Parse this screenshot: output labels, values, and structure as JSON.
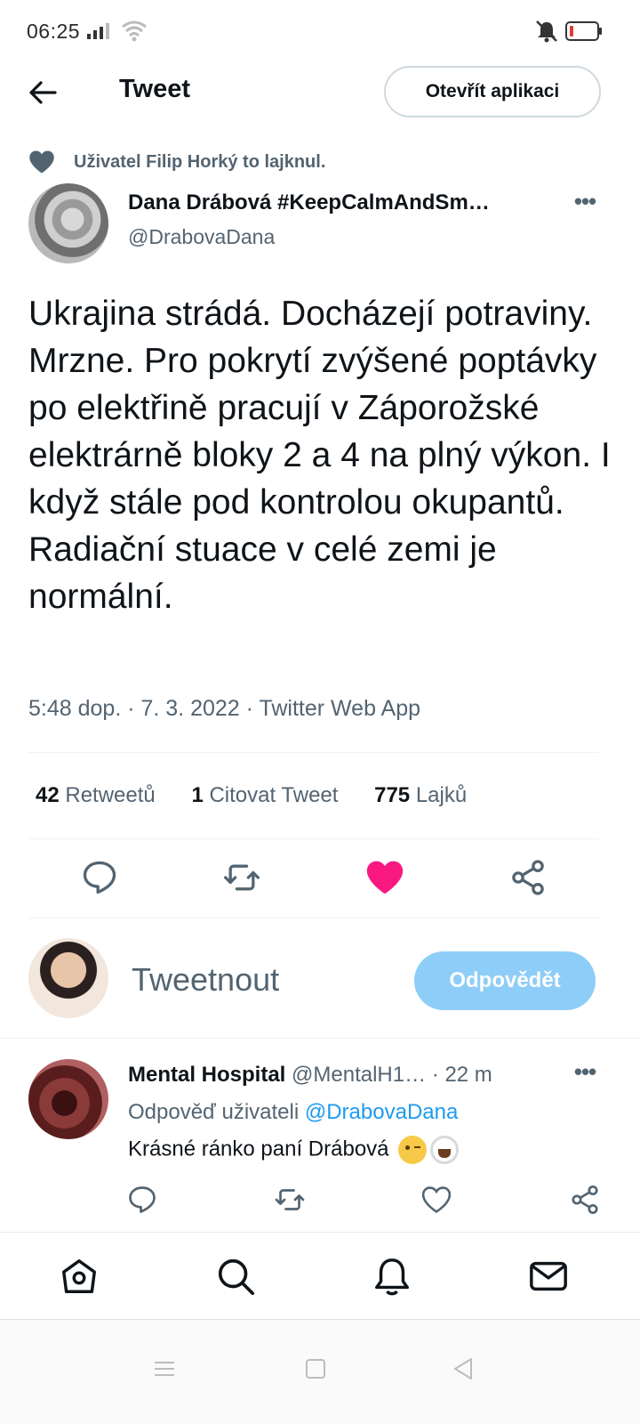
{
  "status_bar": {
    "time": "06:25",
    "icons": [
      "signal-icon",
      "wifi-icon",
      "mute-vibrate-icon",
      "battery-low-icon"
    ]
  },
  "header": {
    "back_icon": "arrow-left-icon",
    "title": "Tweet",
    "open_app_label": "Otevřít aplikaci"
  },
  "social_context": {
    "icon": "heart-icon",
    "text": "Uživatel Filip Horký to lajknul."
  },
  "tweet": {
    "author_name": "Dana Drábová #KeepCalmAndSm…",
    "author_handle": "@DrabovaDana",
    "text": "Ukrajina strádá. Docházejí potraviny. Mrzne. Pro pokrytí zvýšené poptávky po elektřině pracují v Záporožské elektrárně bloky 2 a 4 na plný výkon. I když stále pod kontrolou okupantů. Radiační stuace v celé zemi je normální.",
    "meta": "5:48 dop. · 7. 3. 2022 · Twitter Web App",
    "stats": [
      {
        "count": "42",
        "label": "Retweetů"
      },
      {
        "count": "1",
        "label": "Citovat Tweet"
      },
      {
        "count": "775",
        "label": "Lajků"
      }
    ],
    "liked": true,
    "like_color": "#f91880"
  },
  "compose": {
    "placeholder": "Tweetnout",
    "reply_button": "Odpovědět",
    "reply_button_color": "#8ecdf8"
  },
  "reply": {
    "author_name": "Mental Hospital",
    "author_handle": "@MentalH1…",
    "time": " · 22 m",
    "replying_prefix": "Odpověď uživateli ",
    "replying_to": "@DrabovaDana",
    "text": "Krásné ránko paní Drábová",
    "emojis": [
      "winking-face-emoji",
      "hot-beverage-emoji"
    ]
  },
  "bottom_nav": {
    "items": [
      "home-icon",
      "search-icon",
      "notifications-icon",
      "messages-icon"
    ]
  },
  "system_nav": {
    "items": [
      "menu-icon",
      "home-square-icon",
      "back-triangle-icon"
    ]
  },
  "colors": {
    "accent": "#1d9bf0",
    "secondary_text": "#536471",
    "like": "#f91880"
  }
}
